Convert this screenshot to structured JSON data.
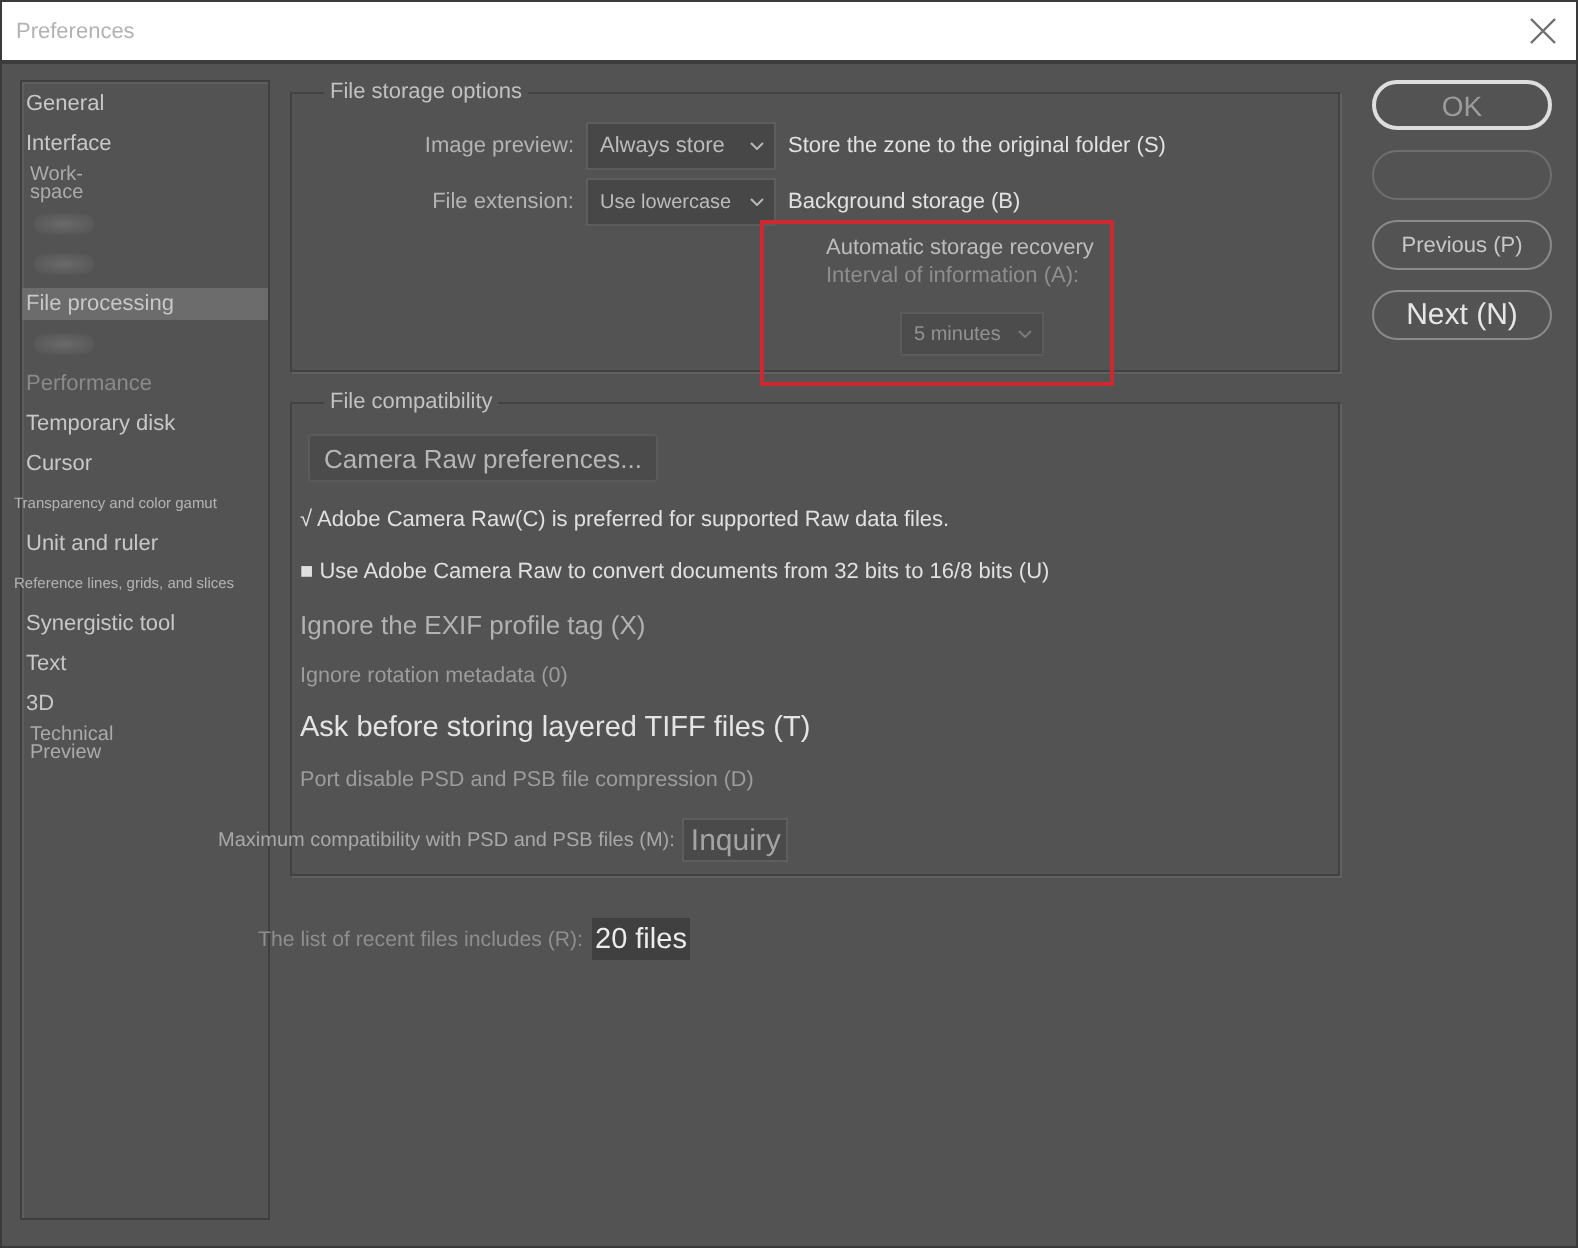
{
  "window": {
    "title": "Preferences"
  },
  "sidebar": {
    "items": [
      {
        "label": "General",
        "kind": "plain",
        "selected": false,
        "disabled": false
      },
      {
        "label": "Interface",
        "kind": "plain",
        "selected": false,
        "disabled": false
      },
      {
        "label": "Work-space",
        "kind": "stacked",
        "selected": false,
        "disabled": false
      },
      {
        "kind": "obscured",
        "selected": false
      },
      {
        "kind": "obscured",
        "selected": false
      },
      {
        "label": "File processing",
        "kind": "plain",
        "selected": true,
        "disabled": false
      },
      {
        "kind": "obscured",
        "selected": false
      },
      {
        "label": "Performance",
        "kind": "plain",
        "selected": false,
        "disabled": true
      },
      {
        "label": "Temporary disk",
        "kind": "plain",
        "selected": false,
        "disabled": false
      },
      {
        "label": "Cursor",
        "kind": "plain",
        "selected": false,
        "disabled": false
      },
      {
        "label": "Transparency and color gamut",
        "kind": "small",
        "selected": false,
        "disabled": false
      },
      {
        "label": "Unit and ruler",
        "kind": "plain",
        "selected": false,
        "disabled": false
      },
      {
        "label": "Reference lines, grids, and slices",
        "kind": "small",
        "selected": false,
        "disabled": false
      },
      {
        "label": "Synergistic tool",
        "kind": "plain",
        "selected": false,
        "disabled": false
      },
      {
        "label": "Text",
        "kind": "plain",
        "selected": false,
        "disabled": false
      },
      {
        "label": "3D",
        "kind": "plain",
        "selected": false,
        "disabled": false
      },
      {
        "label": "Technical Preview",
        "kind": "stacked",
        "selected": false,
        "disabled": false
      }
    ]
  },
  "file_storage": {
    "title": "File storage options",
    "fields": [
      {
        "label": "Image preview:",
        "value": "Always store",
        "note": "Store the zone to the original folder (S)"
      },
      {
        "label": "File extension:",
        "value": "Use lowercase",
        "note": "Background storage (B)"
      }
    ],
    "auto_recovery": {
      "label": "Automatic storage recovery",
      "interval_label": "Interval of information (A):",
      "interval": {
        "value": "5 minutes",
        "disabled": true
      },
      "highlighted": true
    }
  },
  "file_compatibility": {
    "title": "File compatibility",
    "button": "Camera Raw preferences...",
    "options": [
      {
        "label": "√ Adobe Camera Raw(C) is preferred for supported Raw data files.",
        "kind": "plain",
        "disabled": false
      },
      {
        "label": "■ Use Adobe Camera Raw to convert documents from 32 bits to 16/8 bits (U)",
        "kind": "plain",
        "disabled": false
      },
      {
        "label": "Ignore the EXIF profile tag (X)",
        "kind": "large",
        "disabled": true
      },
      {
        "label": "Ignore rotation metadata (0)",
        "kind": "small",
        "disabled": true
      },
      {
        "label": "Ask before storing layered TIFF files (T)",
        "kind": "large",
        "disabled": false
      },
      {
        "label": "Port disable PSD and PSB file compression (D)",
        "kind": "small",
        "disabled": true
      }
    ],
    "max_compat": {
      "label": "Maximum compatibility with PSD and PSB files (M):",
      "value": "Inquiry"
    }
  },
  "recent_files": {
    "label": "The list of recent files includes (R):",
    "value": "20 files"
  },
  "buttons": [
    {
      "label": "OK",
      "kind": "default"
    },
    {
      "kind": "blank"
    },
    {
      "label": "Previous (P)",
      "kind": "plain"
    },
    {
      "label": "Next (N)",
      "kind": "large"
    }
  ]
}
